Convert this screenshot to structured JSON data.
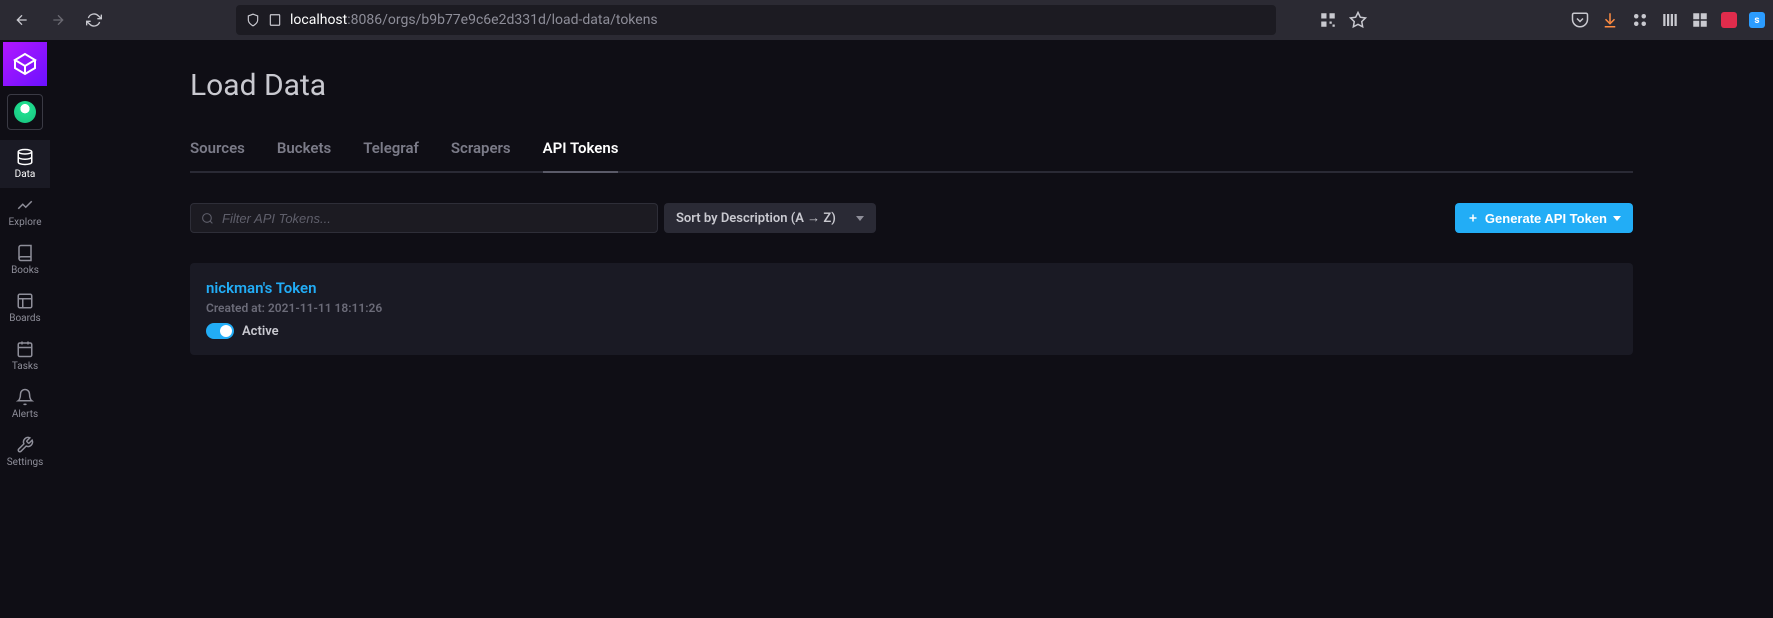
{
  "browser": {
    "url_host": "localhost",
    "url_path": ":8086/orgs/b9b77e9c6e2d331d/load-data/tokens",
    "blue_badge": "s"
  },
  "sidebar": {
    "items": [
      {
        "label": "Data"
      },
      {
        "label": "Explore"
      },
      {
        "label": "Books"
      },
      {
        "label": "Boards"
      },
      {
        "label": "Tasks"
      },
      {
        "label": "Alerts"
      },
      {
        "label": "Settings"
      }
    ]
  },
  "page": {
    "title": "Load Data"
  },
  "tabs": [
    {
      "label": "Sources"
    },
    {
      "label": "Buckets"
    },
    {
      "label": "Telegraf"
    },
    {
      "label": "Scrapers"
    },
    {
      "label": "API Tokens"
    }
  ],
  "toolbar": {
    "search_placeholder": "Filter API Tokens...",
    "sort_label": "Sort by Description (A → Z)",
    "generate_label": "Generate API Token"
  },
  "tokens": [
    {
      "name": "nickman's Token",
      "created": "Created at: 2021-11-11 18:11:26",
      "status_label": "Active"
    }
  ]
}
